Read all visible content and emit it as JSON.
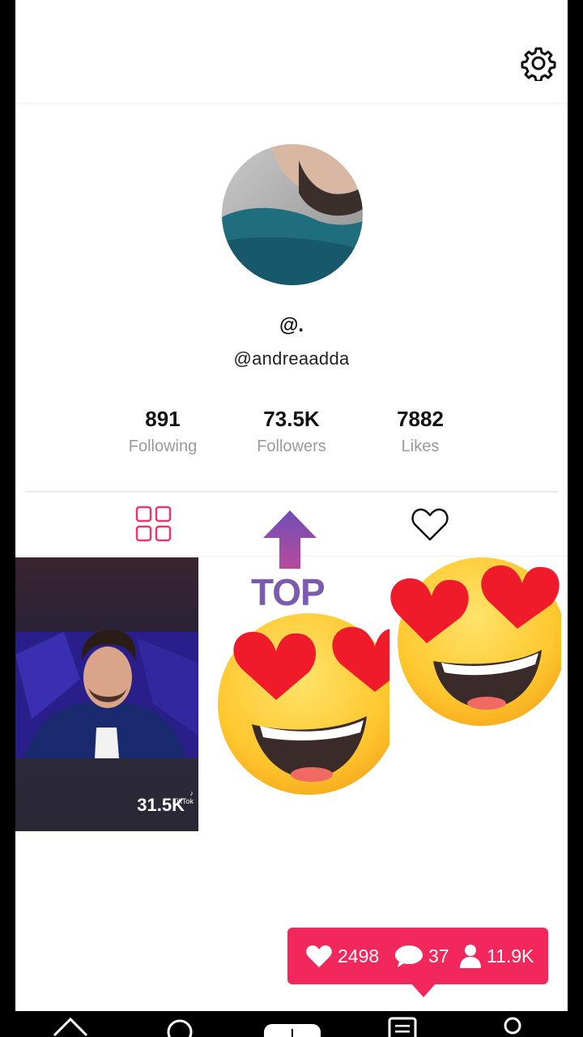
{
  "profile": {
    "display_name": "@.",
    "handle": "@andreaadda"
  },
  "stats": {
    "following": {
      "value": "891",
      "label": "Following"
    },
    "followers": {
      "value": "73.5K",
      "label": "Followers"
    },
    "likes": {
      "value": "7882",
      "label": "Likes"
    }
  },
  "tabs": {
    "videos_icon": "grid-icon",
    "liked_icon": "heart-outline-icon",
    "active_color": "#e8386d"
  },
  "videos": [
    {
      "views": "31.5K",
      "watermark": "TikTok\naadda"
    }
  ],
  "overlay": {
    "top_label": "TOP"
  },
  "live_stats": {
    "likes": "2498",
    "comments": "37",
    "followers": "11.9K",
    "color": "#f2285c"
  },
  "nav": {
    "icons": [
      "home-icon",
      "discover-icon",
      "create-icon",
      "inbox-icon",
      "profile-icon"
    ]
  }
}
